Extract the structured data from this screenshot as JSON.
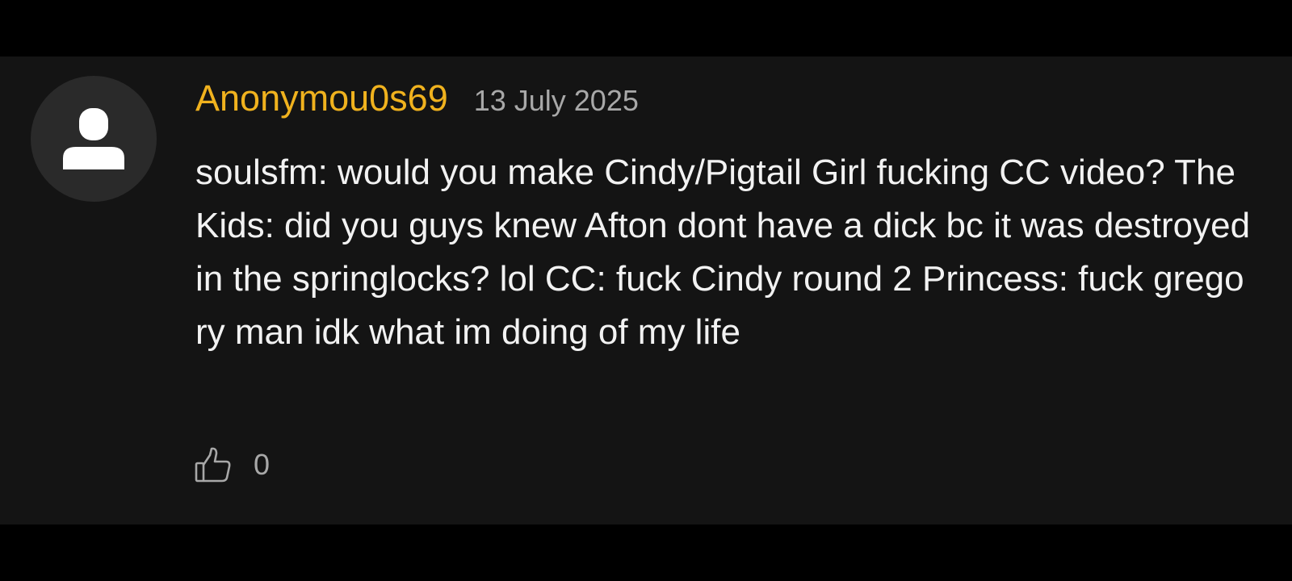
{
  "comment": {
    "username": "Anonymou0s69",
    "date": "13 July 2025",
    "text": "soulsfm: would you make Cindy/Pigtail Girl fucking CC video? The Kids: did you guys knew Afton dont have a dick bc it was destroyed in the springlocks? lol CC: fuck Cindy round 2 Princess: fuck gregory man idk what im doing of my life",
    "like_count": "0",
    "avatar_icon": "user-silhouette-icon",
    "like_icon": "thumbs-up-icon"
  },
  "colors": {
    "username": "#f0b21e",
    "background": "#141414",
    "page": "#000000",
    "text": "#f2f2f2",
    "muted": "#a8a8a8"
  }
}
